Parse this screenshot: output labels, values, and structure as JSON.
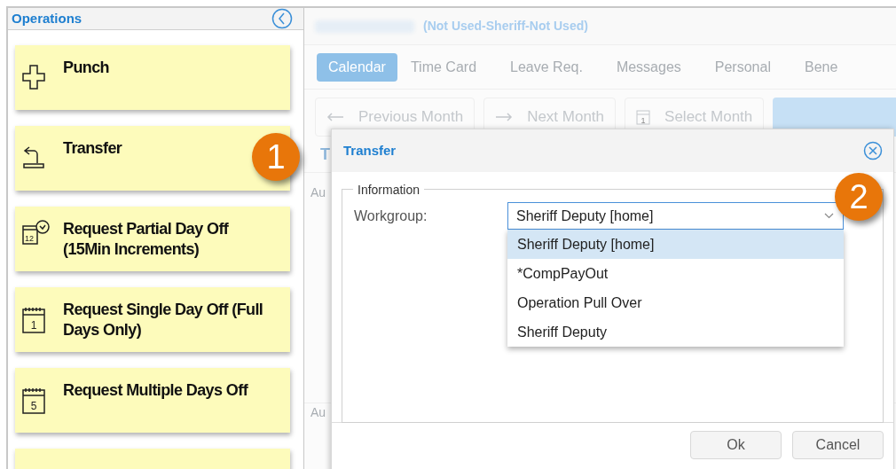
{
  "sidebar": {
    "title": "Operations",
    "items": [
      {
        "label": "Punch",
        "kind": "punch"
      },
      {
        "label": "Transfer",
        "kind": "transfer"
      },
      {
        "label": "Request Partial Day Off (15Min Increments)",
        "kind": "partial",
        "icon_text": "12"
      },
      {
        "label": "Request Single Day Off (Full Days Only)",
        "kind": "single",
        "icon_text": "1"
      },
      {
        "label": "Request Multiple Days Off",
        "kind": "multiple",
        "icon_text": "5"
      }
    ]
  },
  "header": {
    "subtitle": "(Not Used-Sheriff-Not Used)"
  },
  "tabs": [
    {
      "label": "Calendar",
      "selected": true
    },
    {
      "label": "Time Card",
      "selected": false
    },
    {
      "label": "Leave Req.",
      "selected": false
    },
    {
      "label": "Messages",
      "selected": false
    },
    {
      "label": "Personal",
      "selected": false
    },
    {
      "label": "Bene",
      "selected": false
    }
  ],
  "toolbar": [
    {
      "label": "Previous Month",
      "kind": "prev"
    },
    {
      "label": "Next Month",
      "kind": "next"
    },
    {
      "label": "Select Month",
      "kind": "select",
      "icon_text": "1"
    }
  ],
  "calendar": {
    "column": "T",
    "rows": [
      "Au",
      "Au"
    ]
  },
  "dialog": {
    "title": "Transfer",
    "group": "Information",
    "field_label": "Workgroup:",
    "value": "Sheriff Deputy [home]",
    "options": [
      {
        "label": "Sheriff Deputy [home]",
        "selected": true
      },
      {
        "label": "*CompPayOut",
        "selected": false
      },
      {
        "label": "Operation Pull Over",
        "selected": false
      },
      {
        "label": "Sheriff Deputy",
        "selected": false
      }
    ],
    "buttons": [
      "Ok",
      "Cancel"
    ]
  },
  "callouts": [
    "1",
    "2"
  ]
}
